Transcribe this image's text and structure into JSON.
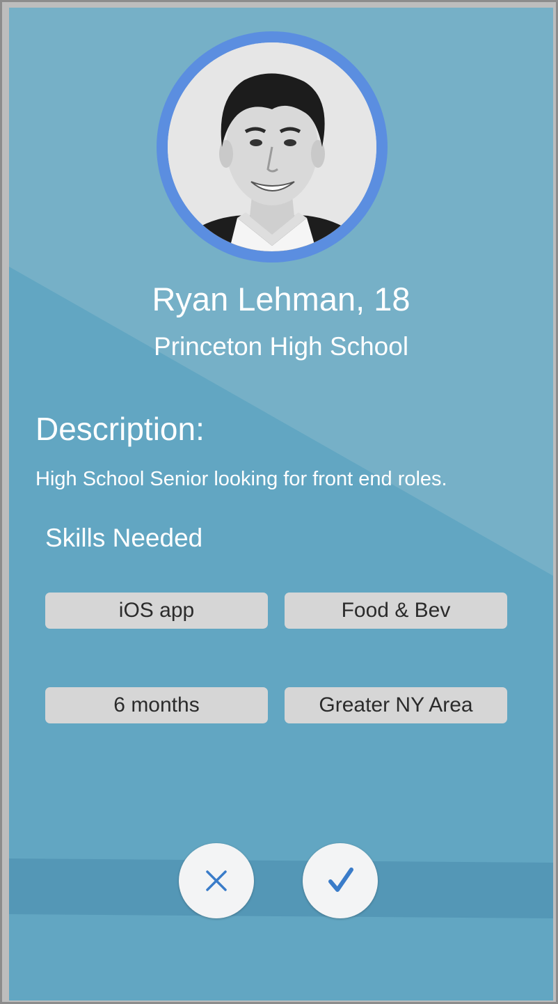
{
  "profile": {
    "name_age": "Ryan Lehman, 18",
    "school": "Princeton High School"
  },
  "description": {
    "heading": "Description:",
    "text": "High School Senior looking for front end roles."
  },
  "skills": {
    "heading": "Skills Needed",
    "tags": [
      "iOS app",
      "Food & Bev",
      "6 months",
      "Greater NY Area"
    ]
  },
  "actions": {
    "reject_icon": "close-icon",
    "accept_icon": "checkmark-icon"
  },
  "colors": {
    "background": "#62a6c2",
    "background_light": "#76b0c7",
    "band": "#5497b6",
    "avatar_ring": "#5b8ee0",
    "tag_background": "#d6d6d6",
    "icon_blue": "#3a7cc9"
  }
}
